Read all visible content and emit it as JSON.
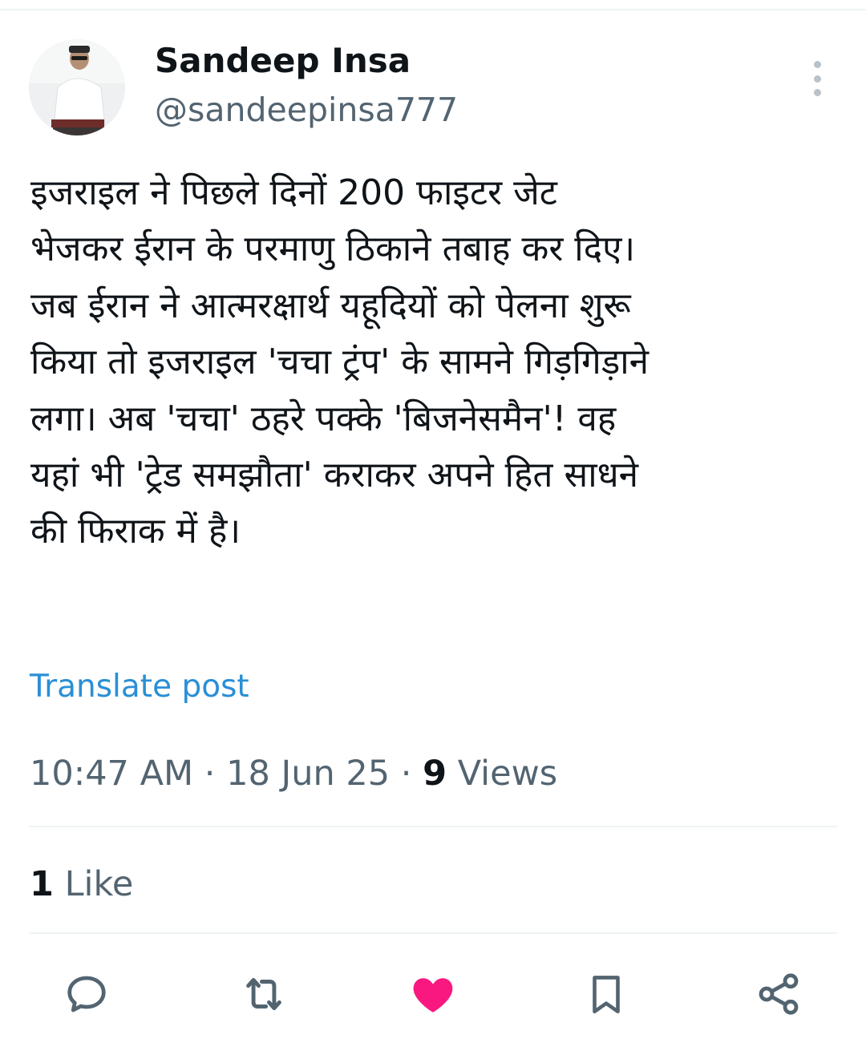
{
  "author": {
    "display_name": "Sandeep Insa",
    "handle": "@sandeepinsa777"
  },
  "tweet": {
    "text": "इजराइल ने पिछले दिनों 200 फाइटर जेट\nभेजकर ईरान के परमाणु ठिकाने तबाह कर दिए।\nजब ईरान ने आत्मरक्षार्थ यहूदियों को पेलना शुरू\nकिया तो इजराइल 'चचा ट्रंप' के सामने गिड़गिड़ाने\nलगा। अब 'चचा' ठहरे पक्के 'बिजनेसमैन'! वह\nयहां भी 'ट्रेड समझौता' कराकर अपने हित साधने\nकी फिराक में है।",
    "translate_label": "Translate post"
  },
  "meta": {
    "time": "10:47 AM",
    "separator": " · ",
    "date": "18 Jun 25",
    "views_count": "9",
    "views_label": " Views"
  },
  "engagement": {
    "like_count": "1",
    "like_label": " Like"
  },
  "actions": {
    "icons": [
      "reply-icon",
      "retweet-icon",
      "like-icon",
      "bookmark-icon",
      "share-icon"
    ],
    "like_active_color": "#f91880",
    "icon_color": "#536471"
  },
  "colors": {
    "link": "#1d9bf0",
    "secondary_text": "#536471",
    "primary_text": "#0f1419"
  }
}
